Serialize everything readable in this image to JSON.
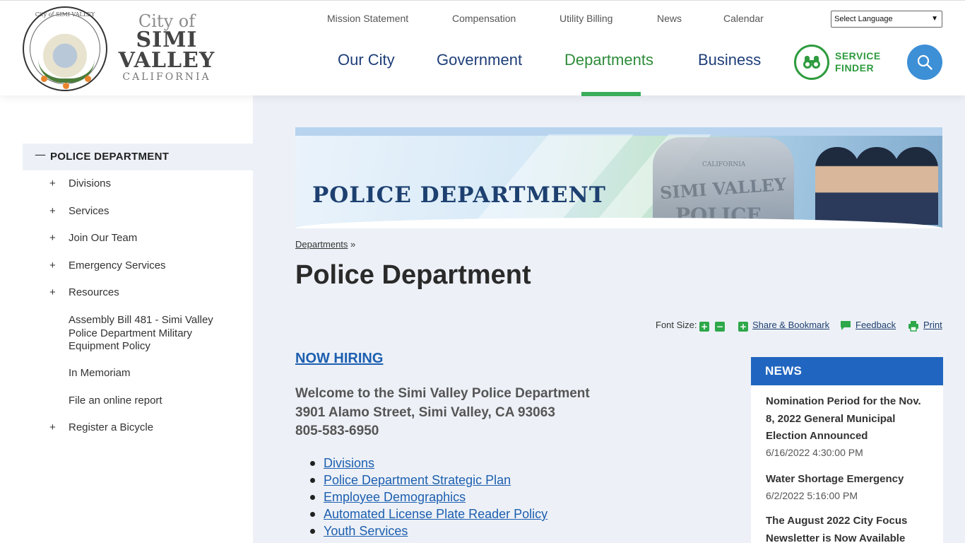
{
  "header": {
    "wordmark": {
      "line1": "City of",
      "line2": "SIMI",
      "line3": "VALLEY",
      "line4": "CALIFORNIA"
    },
    "seal_text": "City of SIMI VALLEY",
    "utility_links": [
      "Mission Statement",
      "Compensation",
      "Utility Billing",
      "News",
      "Calendar"
    ],
    "language_select": "Select Language",
    "main_nav": [
      "Our City",
      "Government",
      "Departments",
      "Business"
    ],
    "active_nav": "Departments",
    "service_finder": {
      "line1": "SERVICE",
      "line2": "FINDER"
    },
    "colors": {
      "nav": "#1e3e78",
      "active": "#2e8c3a",
      "accent_green": "#3aad5a",
      "search_blue": "#3d8fd6"
    }
  },
  "sidebar": {
    "heading": "POLICE DEPARTMENT",
    "items": [
      {
        "label": "Divisions",
        "expandable": true
      },
      {
        "label": "Services",
        "expandable": true
      },
      {
        "label": "Join Our Team",
        "expandable": true
      },
      {
        "label": "Emergency Services",
        "expandable": true
      },
      {
        "label": "Resources",
        "expandable": true
      },
      {
        "label": "Assembly Bill 481 - Simi Valley Police Department Military Equipment Policy",
        "expandable": false
      },
      {
        "label": "In Memoriam",
        "expandable": false
      },
      {
        "label": "File an online report",
        "expandable": false
      },
      {
        "label": "Register a Bicycle",
        "expandable": true
      }
    ]
  },
  "main": {
    "banner": {
      "title": "POLICE DEPARTMENT",
      "badge_line1": "SIMI VALLEY",
      "badge_line2": "POLICE",
      "badge_small": "CALIFORNIA"
    },
    "breadcrumb": {
      "link": "Departments",
      "separator": "»"
    },
    "page_title": "Police Department",
    "tools": {
      "font_size_label": "Font Size:",
      "increase": "+",
      "decrease": "−",
      "share": "Share & Bookmark",
      "feedback": "Feedback",
      "print": "Print"
    },
    "now_hiring": "NOW HIRING",
    "welcome": {
      "line1": "Welcome to the Simi Valley Police Department",
      "line2": "3901 Alamo Street, Simi Valley, CA 93063",
      "line3": "805-583-6950"
    },
    "links": [
      "Divisions",
      "Police Department Strategic Plan",
      "Employee Demographics",
      "Automated License Plate Reader Policy",
      "Youth Services"
    ]
  },
  "news": {
    "heading": "NEWS",
    "items": [
      {
        "title": "Nomination Period for the Nov. 8, 2022 General Municipal Election Announced",
        "date": "6/16/2022 4:30:00 PM"
      },
      {
        "title": "Water Shortage Emergency",
        "date": "6/2/2022 5:16:00 PM"
      },
      {
        "title": "The August 2022 City Focus Newsletter is Now Available",
        "date": ""
      }
    ]
  }
}
